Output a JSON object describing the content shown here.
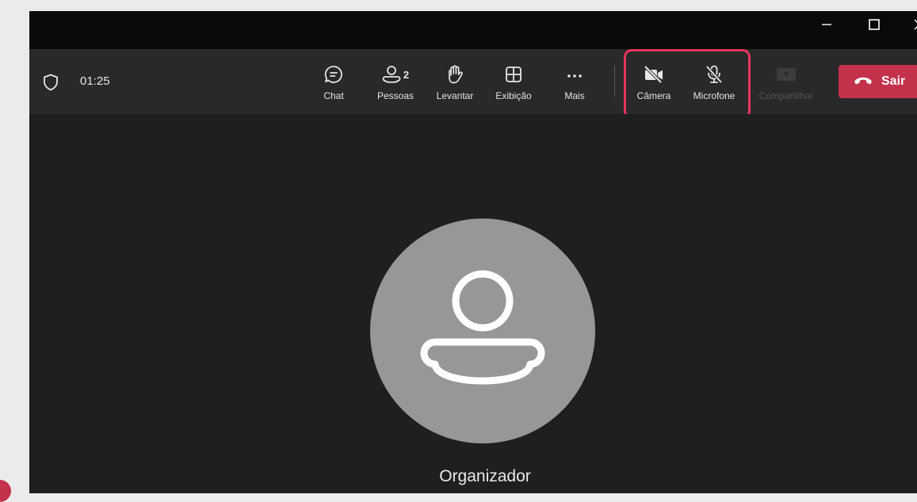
{
  "meeting": {
    "timer": "01:25"
  },
  "toolbar": {
    "chat_label": "Chat",
    "people_label": "Pessoas",
    "people_count": "2",
    "raise_hand_label": "Levantar",
    "view_label": "Exibição",
    "more_label": "Mais",
    "camera_label": "Câmera",
    "mic_label": "Microfone",
    "share_label": "Compartilhar",
    "leave_label": "Sair"
  },
  "participant": {
    "name": "Organizador"
  },
  "colors": {
    "accent_red": "#c4314b",
    "highlight_pink": "#e8345c",
    "avatar_gray": "#979797",
    "toolbar_bg": "#292929",
    "stage_bg": "#1f1f1f"
  },
  "icons": [
    "shield-icon",
    "chat-icon",
    "people-icon",
    "hand-icon",
    "grid-icon",
    "more-icon",
    "camera-off-icon",
    "mic-off-icon",
    "share-icon",
    "phone-hangup-icon",
    "person-icon",
    "minimize-icon",
    "maximize-icon",
    "close-icon"
  ],
  "state": {
    "camera_on": false,
    "mic_on": false,
    "share_enabled": false
  }
}
